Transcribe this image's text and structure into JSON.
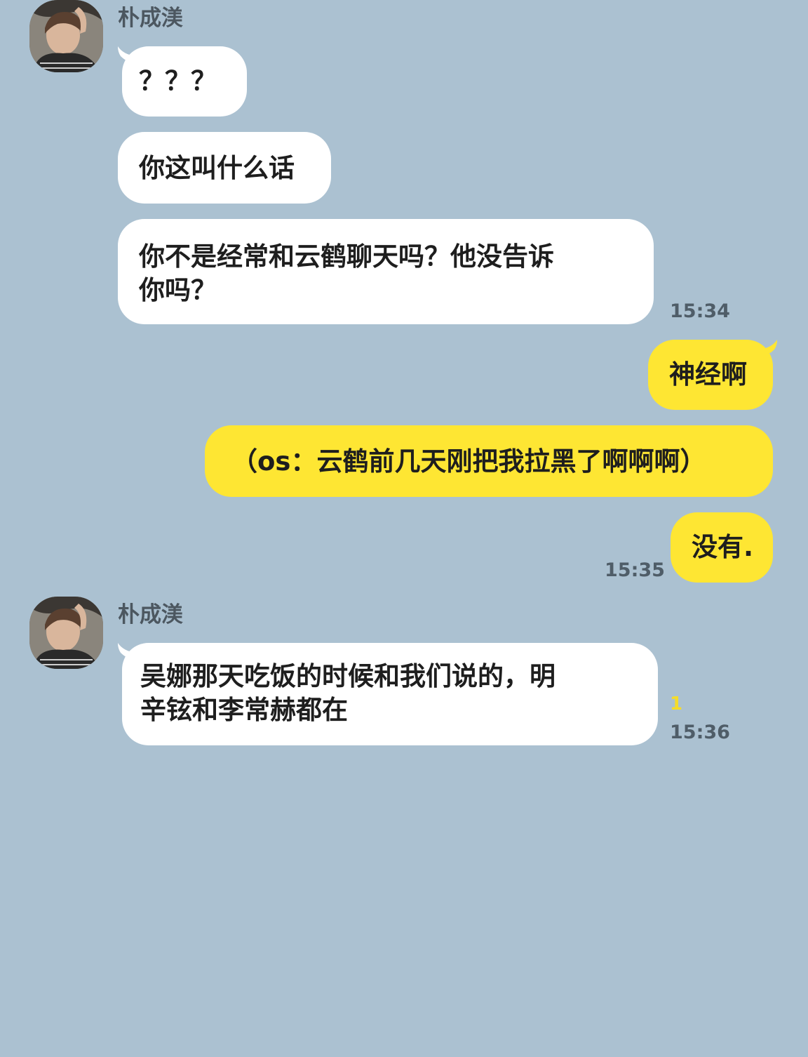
{
  "chat": {
    "groups": [
      {
        "sender": "朴成渼",
        "messages": [
          "？？？",
          "你这叫什么话",
          "你不是经常和云鹤聊天吗？他没告诉你吗？"
        ],
        "time": "15:34"
      },
      {
        "sender": "me",
        "messages": [
          "神经啊",
          "（os：云鹤前几天刚把我拉黑了啊啊啊）",
          "没有."
        ],
        "time": "15:35"
      },
      {
        "sender": "朴成渼",
        "messages": [
          "吴娜那天吃饭的时候和我们说的，明辛铉和李常赫都在"
        ],
        "unread": "1",
        "time": "15:36"
      }
    ],
    "lines": {
      "m3_line1": "你不是经常和云鹤聊天吗？他没告诉",
      "m3_line2": "你吗？",
      "m7_line1": "吴娜那天吃饭的时候和我们说的，明",
      "m7_line2": "辛铉和李常赫都在"
    }
  },
  "colors": {
    "background": "#abc1d1",
    "incoming_bubble": "#ffffff",
    "outgoing_bubble": "#fee633",
    "unread_count": "#f5dc2a"
  },
  "icons": {
    "avatar": "profile-photo"
  }
}
